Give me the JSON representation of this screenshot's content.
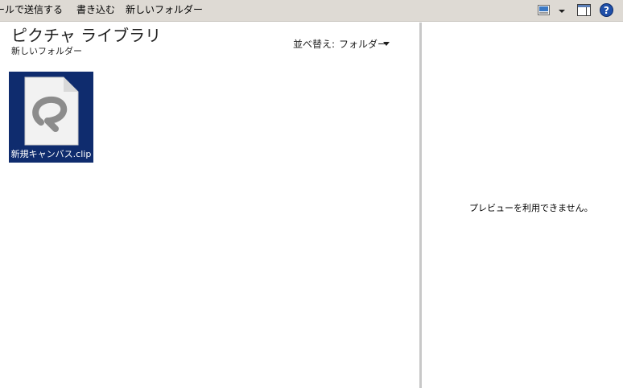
{
  "toolbar": {
    "email_label": "ールで送信する",
    "write_label": "書き込む",
    "new_folder_label": "新しいフォルダー",
    "icons": [
      "change-view-icon",
      "chevron-down-icon",
      "preview-pane-icon",
      "help-icon"
    ]
  },
  "library": {
    "title": "ピクチャ ライブラリ",
    "subtitle": "新しいフォルダー",
    "sort_label": "並べ替え:",
    "sort_value": "フォルダー"
  },
  "files": [
    {
      "name": "新規キャンバス.clip",
      "icon": "clip-studio-file-icon"
    }
  ],
  "preview": {
    "message": "プレビューを利用できません。"
  },
  "colors": {
    "toolbar_bg": "#dedad4",
    "selection": "#0f2c6e",
    "help_blue": "#1f4fa8"
  }
}
